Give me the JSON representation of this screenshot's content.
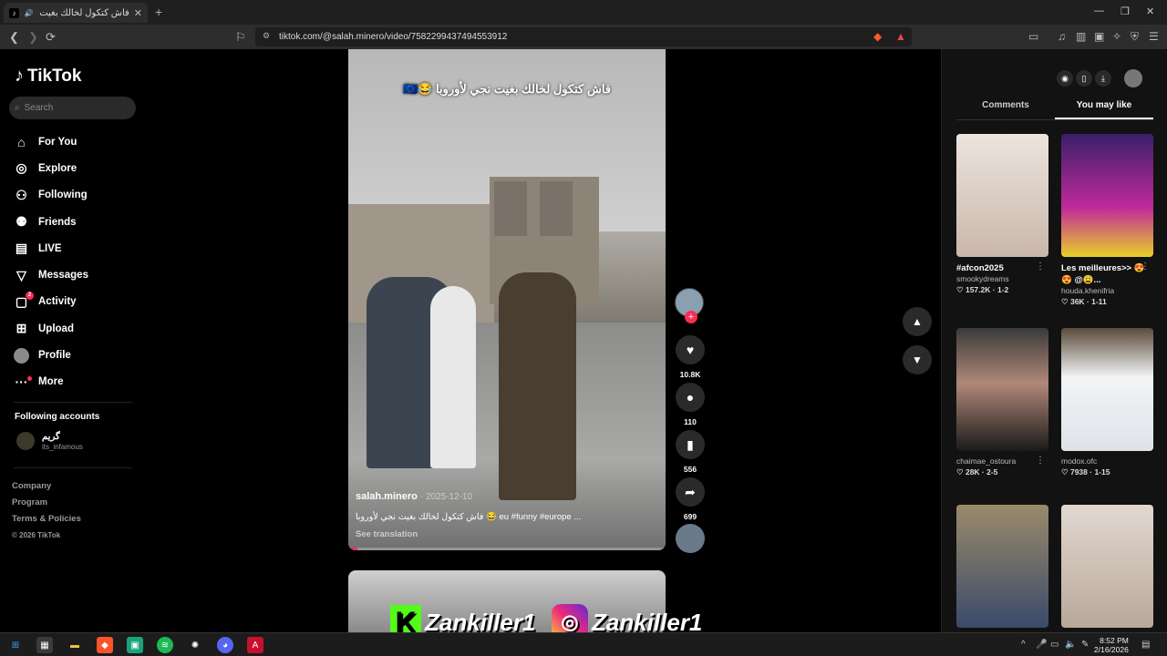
{
  "browser": {
    "tab_title": "فاش كتكول لخالك بغيت نجي لأ",
    "tab_close": "✕",
    "new_tab": "+",
    "url": "tiktok.com/@salah.minero/video/7582299437494553912",
    "win_min": "—",
    "win_max": "❐",
    "win_close": "✕"
  },
  "sidebar": {
    "logo": "TikTok",
    "search_placeholder": "Search",
    "items": [
      {
        "label": "For You",
        "icon": "home-icon"
      },
      {
        "label": "Explore",
        "icon": "compass-icon"
      },
      {
        "label": "Following",
        "icon": "following-icon"
      },
      {
        "label": "Friends",
        "icon": "friends-icon"
      },
      {
        "label": "LIVE",
        "icon": "live-icon"
      },
      {
        "label": "Messages",
        "icon": "messages-icon"
      },
      {
        "label": "Activity",
        "icon": "activity-icon",
        "badge": "2"
      },
      {
        "label": "Upload",
        "icon": "upload-icon"
      },
      {
        "label": "Profile",
        "icon": "profile-avatar"
      },
      {
        "label": "More",
        "icon": "more-icon"
      }
    ],
    "following_heading": "Following accounts",
    "account": {
      "name": "گريم",
      "handle": "its_infamous"
    },
    "footer": {
      "company": "Company",
      "program": "Program",
      "terms": "Terms & Policies",
      "copyright": "© 2026 TikTok"
    }
  },
  "video": {
    "overlay_caption": "فاش كتكول لخالك بغيت نجي لأوروبا 😂🇪🇺",
    "username": "salah.minero",
    "date": "· 2025-12-10",
    "description": "فاش كتكول لخالك بغيت نجي لأوروبا 😂 eu #funny #europe ...",
    "see_translation": "See translation",
    "progress": 0.03
  },
  "actions": {
    "likes": "10.8K",
    "comments": "110",
    "saves": "556",
    "shares": "699"
  },
  "watermark": {
    "kick": "Zankiller1",
    "instagram": "Zankiller1"
  },
  "right_panel": {
    "tabs": [
      "Comments",
      "You may like"
    ],
    "active_tab": "You may like",
    "cards": [
      {
        "title": "#afcon2025",
        "author": "smookydreams",
        "stats": "♡ 157.2K · 1-2",
        "color": "#e8dcd5"
      },
      {
        "title": "Les meilleures>> 😍😍 @😩...",
        "author": "houda.khenifria",
        "stats": "♡ 36K · 1-11",
        "color": "#6a3a9a"
      },
      {
        "title": "",
        "author": "chaimae_ostoura",
        "stats": "♡ 28K · 2-5",
        "color": "#2a2a2a"
      },
      {
        "title": "",
        "author": "modox.ofc",
        "stats": "♡ 7938 · 1-15",
        "color": "#d8dde4"
      },
      {
        "title": "",
        "author": "",
        "stats": "",
        "color": "#8a8070"
      },
      {
        "title": "",
        "author": "",
        "stats": "",
        "color": "#d9cfc7"
      }
    ]
  },
  "taskbar": {
    "time": "8:52 PM",
    "date": "2/16/2026"
  },
  "colors": {
    "accent": "#fe2c55",
    "background": "#000000",
    "panel": "#121212"
  }
}
